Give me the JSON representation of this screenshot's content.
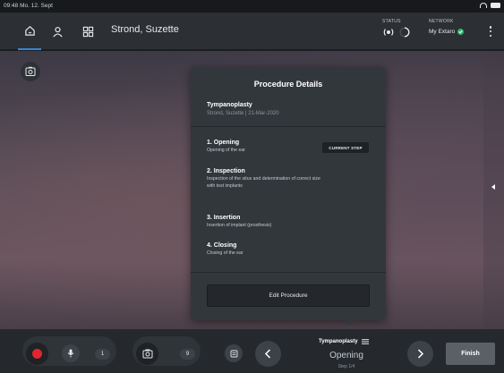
{
  "statusbar": {
    "time": "09:48  Mo. 12. Sept",
    "icons": [
      "wifi-icon",
      "battery-icon"
    ]
  },
  "topnav": {
    "icons": [
      "home-icon",
      "user-icon",
      "grid-icon",
      "more-vertical-icon"
    ],
    "active_tab": "home",
    "patient_name": "Strond, Suzette",
    "status_label": "STATUS",
    "network_label": "NETWORK",
    "network_value": "My Extaro"
  },
  "video": {
    "snapshot_icon": "camera-screen-icon",
    "side_arrow_icon": "chevron-left-icon"
  },
  "panel": {
    "title": "Procedure Details",
    "procedure": "Tympanoplasty",
    "subtitle": "Strond, Suzette | 21-Mar-2020",
    "current_step_badge": "CURRENT STEP",
    "steps": [
      {
        "title": "1. Opening",
        "desc": "Opening of the ear"
      },
      {
        "title": "2. Inspection",
        "desc": "Inspection of the situs and determination of correct size with test implants"
      },
      {
        "title": "3. Insertion",
        "desc": "Insertion of implant (prosthesis)"
      },
      {
        "title": "4. Closing",
        "desc": "Closing of the ear"
      }
    ],
    "edit_button": "Edit Procedure"
  },
  "bottombar": {
    "mic_count": "1",
    "photo_count": "9",
    "procedure": "Tympanoplasty",
    "step_name": "Opening",
    "step_count": "Step 1/4",
    "finish_button": "Finish"
  },
  "colors": {
    "accent": "#3a86d4",
    "record": "#e0262f",
    "network_ok": "#2fb96b",
    "panel": "#32373c"
  }
}
